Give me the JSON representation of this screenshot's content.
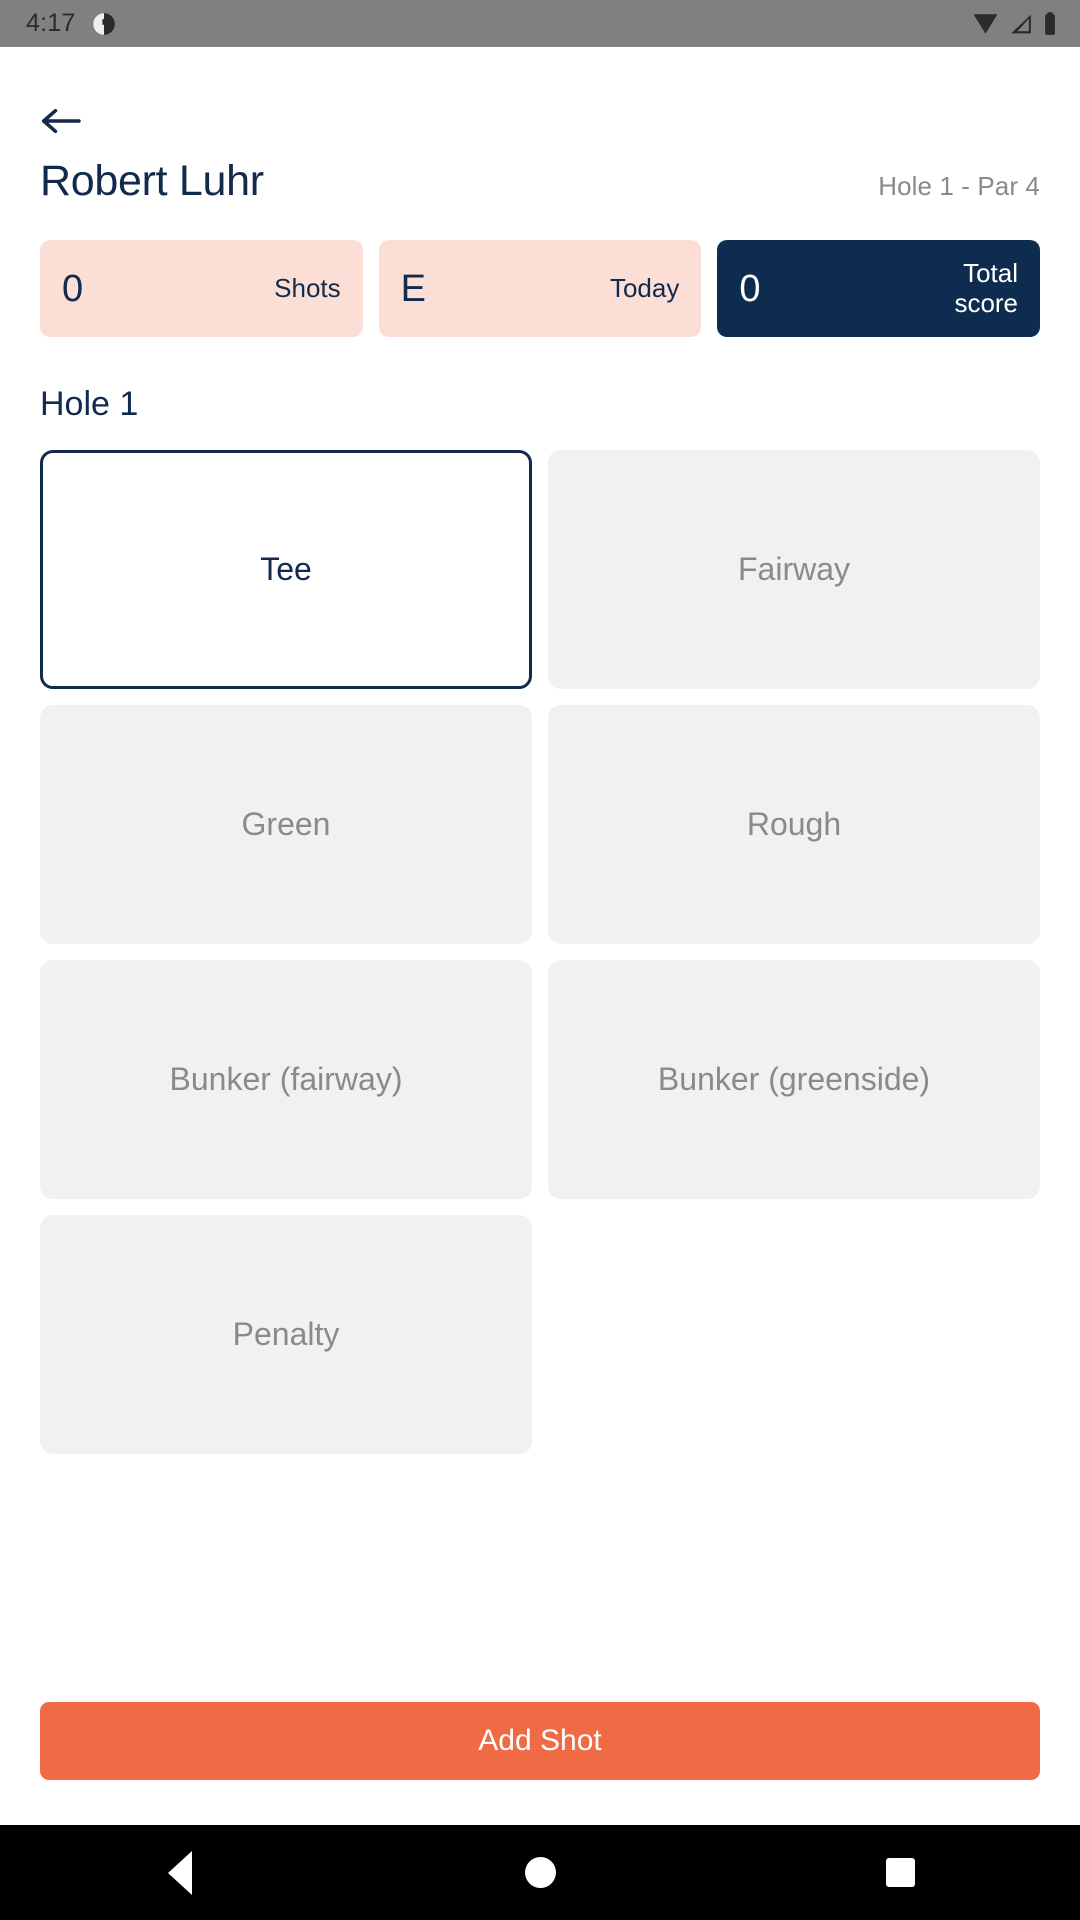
{
  "status_bar": {
    "time": "4:17",
    "left_icon": "app-notification-icon",
    "right_icons": [
      "wifi-icon",
      "cellular-signal-icon",
      "battery-icon"
    ],
    "background_color": "#808080"
  },
  "header": {
    "back_icon": "back-arrow-icon",
    "player_name": "Robert Luhr",
    "hole_info": "Hole 1 - Par 4"
  },
  "stats": [
    {
      "value": "0",
      "label": "Shots",
      "style": "pink",
      "bg": "#fbdfd7",
      "fg": "#122a4b"
    },
    {
      "value": "E",
      "label": "Today",
      "style": "pink",
      "bg": "#fbdfd7",
      "fg": "#122a4b"
    },
    {
      "value": "0",
      "label": "Total score",
      "style": "navy",
      "bg": "#0e2c50",
      "fg": "#ffffff"
    }
  ],
  "section": {
    "title": "Hole 1"
  },
  "lies": [
    {
      "label": "Tee",
      "selected": true
    },
    {
      "label": "Fairway",
      "selected": false
    },
    {
      "label": "Green",
      "selected": false
    },
    {
      "label": "Rough",
      "selected": false
    },
    {
      "label": "Bunker (fairway)",
      "selected": false
    },
    {
      "label": "Bunker (greenside)",
      "selected": false
    },
    {
      "label": "Penalty",
      "selected": false
    }
  ],
  "primary_action": {
    "label": "Add Shot",
    "color": "#ef6a45"
  },
  "nav_bar": {
    "back": "nav-back-icon",
    "home": "nav-home-icon",
    "recents": "nav-recents-icon"
  },
  "theme": {
    "navy": "#122a4b",
    "pink": "#fbdfd7",
    "orange": "#ef6a45",
    "gray_card": "#f1f1f1",
    "gray_text": "#8a8a8a"
  }
}
